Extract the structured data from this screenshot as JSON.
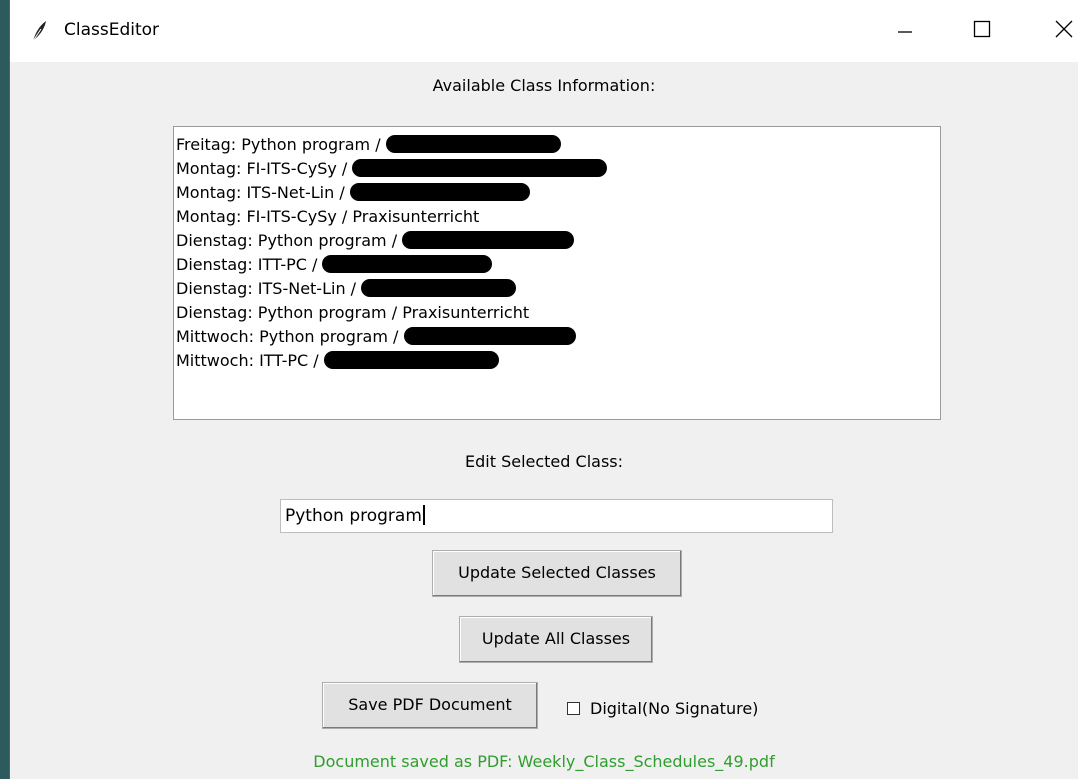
{
  "window": {
    "title": "ClassEditor",
    "app_icon": "feather-icon",
    "controls": [
      "minimize-icon",
      "maximize-icon",
      "close-icon"
    ]
  },
  "available_label": "Available Class Information:",
  "class_list": [
    {
      "text": "Freitag: Python program / ",
      "redacted": true
    },
    {
      "text": "Montag: FI-ITS-CySy / ",
      "redacted": true
    },
    {
      "text": "Montag: ITS-Net-Lin / ",
      "redacted": true
    },
    {
      "text": "Montag: FI-ITS-CySy / Praxisunterricht",
      "redacted": false
    },
    {
      "text": "Dienstag: Python program / ",
      "redacted": true
    },
    {
      "text": "Dienstag: ITT-PC / ",
      "redacted": true
    },
    {
      "text": "Dienstag: ITS-Net-Lin / ",
      "redacted": true
    },
    {
      "text": "Dienstag: Python program / Praxisunterricht",
      "redacted": false
    },
    {
      "text": "Mittwoch: Python program / ",
      "redacted": true
    },
    {
      "text": "Mittwoch: ITT-PC / ",
      "redacted": true
    }
  ],
  "edit_label": "Edit Selected Class:",
  "edit_value": "Python program",
  "buttons": {
    "update_selected": "Update Selected Classes",
    "update_all": "Update All Classes",
    "save_pdf": "Save PDF Document"
  },
  "digital_checkbox": {
    "label": "Digital(No Signature)",
    "checked": false
  },
  "status_message": "Document saved as PDF: Weekly_Class_Schedules_49.pdf",
  "colors": {
    "status_text": "#2e9e2e",
    "background": "#f0f0f0",
    "desktop": "#2d5a5c"
  }
}
